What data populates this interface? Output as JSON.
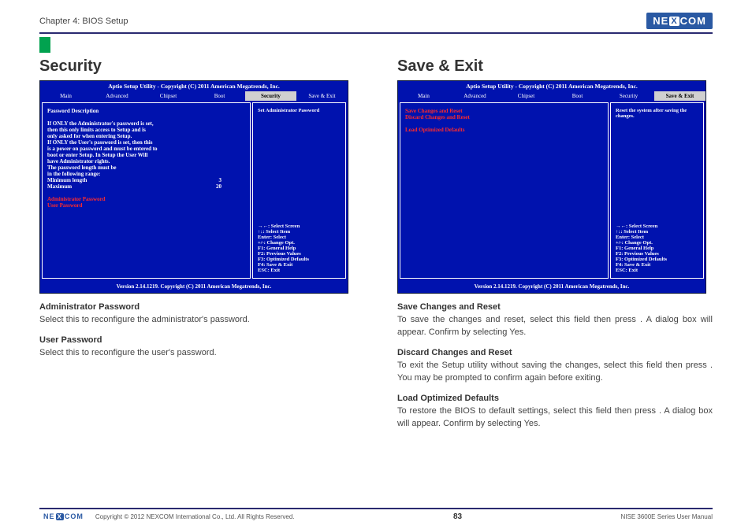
{
  "chapter": "Chapter 4: BIOS Setup",
  "logo": {
    "pre": "NE",
    "x": "X",
    "post": "COM"
  },
  "left": {
    "heading": "Security",
    "bios": {
      "title": "Aptio Setup Utility - Copyright (C) 2011 American Megatrends, Inc.",
      "tabs": [
        "Main",
        "Advanced",
        "Chipset",
        "Boot",
        "Security",
        "Save & Exit"
      ],
      "active_tab": "Security",
      "body_lines": [
        "Password Description",
        "",
        "If ONLY the Administrator's password is set,",
        "then this only limits access to Setup and is",
        "only asked for when entering Setup.",
        "If ONLY the User's password is set, then this",
        "is a power on password and must be entered to",
        "boot or enter Setup. In Setup the User Will",
        "have Administrator rights.",
        "The password length must be",
        "in the following range:"
      ],
      "rows": [
        {
          "k": "Minimum length",
          "v": "3"
        },
        {
          "k": "Maximum",
          "v": "20"
        }
      ],
      "red_items": [
        "Administrator Password",
        "User Password"
      ],
      "help_top": "Set Administrator Password",
      "footer": "Version 2.14.1219. Copyright (C) 2011 American Megatrends, Inc."
    },
    "notes": [
      {
        "t": "Administrator Password",
        "b": "Select this to reconfigure the administrator's password."
      },
      {
        "t": "User Password",
        "b": "Select this to reconfigure the user's password."
      }
    ]
  },
  "right": {
    "heading": "Save & Exit",
    "bios": {
      "title": "Aptio Setup Utility - Copyright (C) 2011 American Megatrends, Inc.",
      "tabs": [
        "Main",
        "Advanced",
        "Chipset",
        "Boot",
        "Security",
        "Save & Exit"
      ],
      "active_tab": "Save & Exit",
      "red_items": [
        "Save Changes and Reset",
        "Discard Changes and Reset",
        "",
        "Load Optimized Defaults"
      ],
      "help_top": "Reset the system after saving the changes.",
      "footer": "Version 2.14.1219. Copyright (C) 2011 American Megatrends, Inc."
    },
    "notes": [
      {
        "t": "Save Changes and Reset",
        "b": "To save the changes and reset, select this field then press <Enter>. A dialog box will appear. Confirm by selecting Yes."
      },
      {
        "t": "Discard Changes and Reset",
        "b": "To exit the Setup utility without saving the changes, select this field then press <Enter>. You may be prompted to confirm again before exiting."
      },
      {
        "t": "Load Optimized Defaults",
        "b": "To restore the BIOS to default settings, select this field then press <Enter>. A dialog box will appear. Confirm by selecting Yes."
      }
    ]
  },
  "keys": [
    "→←: Select Screen",
    "↑↓: Select Item",
    "Enter: Select",
    "+/-: Change Opt.",
    "F1: General Help",
    "F2: Previous Values",
    "F3: Optimized Defaults",
    "F4: Save & Exit",
    "ESC: Exit"
  ],
  "footer": {
    "copy": "Copyright © 2012 NEXCOM International Co., Ltd. All Rights Reserved.",
    "page": "83",
    "manual": "NISE 3600E Series User Manual"
  }
}
